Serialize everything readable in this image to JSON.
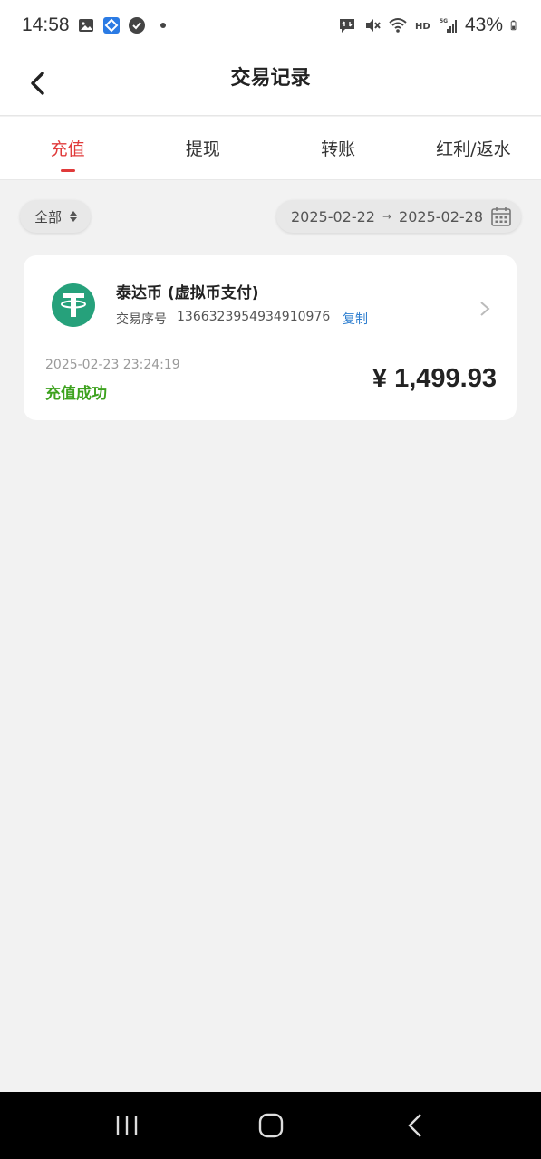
{
  "status_bar": {
    "time": "14:58",
    "battery": "43%"
  },
  "header": {
    "title": "交易记录"
  },
  "tabs": [
    {
      "label": "充值",
      "active": true
    },
    {
      "label": "提现",
      "active": false
    },
    {
      "label": "转账",
      "active": false
    },
    {
      "label": "红利/返水",
      "active": false
    }
  ],
  "filters": {
    "type_label": "全部",
    "start_date": "2025-02-22",
    "separator": "→",
    "end_date": "2025-02-28"
  },
  "records": [
    {
      "coin_name": "泰达币 (虚拟币支付)",
      "txn_label": "交易序号",
      "txn_id": "1366323954934910976",
      "copy_label": "复制",
      "time": "2025-02-23 23:24:19",
      "status": "充值成功",
      "amount": "¥ 1,499.93"
    }
  ],
  "colors": {
    "accent": "#e03a3a",
    "success": "#3ea21f",
    "link": "#2f7fd0",
    "tether": "#26a17b"
  }
}
